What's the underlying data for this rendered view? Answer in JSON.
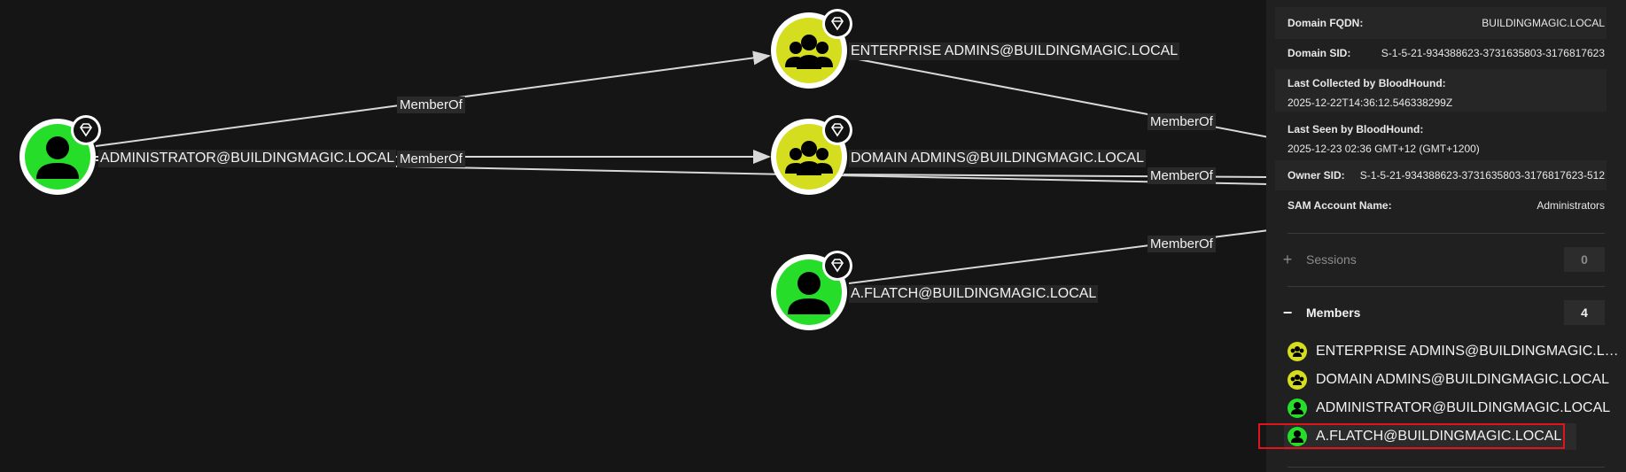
{
  "graph": {
    "nodes": {
      "administrator": {
        "label": "ADMINISTRATOR@BUILDINGMAGIC.LOCAL",
        "kind": "user",
        "icon": "user-icon",
        "badge": "tier-zero-gem-icon"
      },
      "enterprise_admins": {
        "label": "ENTERPRISE ADMINS@BUILDINGMAGIC.LOCAL",
        "kind": "group",
        "icon": "group-icon",
        "badge": "tier-zero-gem-icon"
      },
      "domain_admins": {
        "label": "DOMAIN ADMINS@BUILDINGMAGIC.LOCAL",
        "kind": "group",
        "icon": "group-icon",
        "badge": "tier-zero-gem-icon"
      },
      "aflatch": {
        "label": "A.FLATCH@BUILDINGMAGIC.LOCAL",
        "kind": "user",
        "icon": "user-icon",
        "badge": "tier-zero-gem-icon"
      }
    },
    "edges": [
      {
        "from": "ADMINISTRATOR@BUILDINGMAGIC.LOCAL",
        "to": "ENTERPRISE ADMINS@BUILDINGMAGIC.LOCAL",
        "label": "MemberOf"
      },
      {
        "from": "ADMINISTRATOR@BUILDINGMAGIC.LOCAL",
        "to": "DOMAIN ADMINS@BUILDINGMAGIC.LOCAL",
        "label": "MemberOf"
      },
      {
        "from": "ENTERPRISE ADMINS@BUILDINGMAGIC.LOCAL",
        "to": "Administrators",
        "label": "MemberOf"
      },
      {
        "from": "DOMAIN ADMINS@BUILDINGMAGIC.LOCAL",
        "to": "Administrators",
        "label": "MemberOf"
      },
      {
        "from": "A.FLATCH@BUILDINGMAGIC.LOCAL",
        "to": "Administrators",
        "label": "MemberOf"
      }
    ]
  },
  "panel": {
    "properties": [
      {
        "key": "Domain FQDN:",
        "value": "BUILDINGMAGIC.LOCAL"
      },
      {
        "key": "Domain SID:",
        "value": "S-1-5-21-934388623-3731635803-3176817623"
      },
      {
        "key": "Last Collected by BloodHound:",
        "value": "2025-12-22T14:36:12.546338299Z"
      },
      {
        "key": "Last Seen by BloodHound:",
        "value": "2025-12-23 02:36 GMT+12 (GMT+1200)"
      },
      {
        "key": "Owner SID:",
        "value": "S-1-5-21-934388623-3731635803-3176817623-512"
      },
      {
        "key": "SAM Account Name:",
        "value": "Administrators"
      }
    ],
    "sessions": {
      "symbol": "+",
      "label": "Sessions",
      "count": "0"
    },
    "members": {
      "symbol": "−",
      "label": "Members",
      "count": "4",
      "items": [
        {
          "label": "ENTERPRISE ADMINS@BUILDINGMAGIC.L…",
          "kind": "group",
          "icon": "group-icon"
        },
        {
          "label": "DOMAIN ADMINS@BUILDINGMAGIC.LOCAL",
          "kind": "group",
          "icon": "group-icon"
        },
        {
          "label": "ADMINISTRATOR@BUILDINGMAGIC.LOCAL",
          "kind": "user",
          "icon": "user-icon"
        },
        {
          "label": "A.FLATCH@BUILDINGMAGIC.LOCAL",
          "kind": "user",
          "icon": "user-icon",
          "selected": true
        }
      ]
    }
  },
  "colors": {
    "user": "#26dd2a",
    "group": "#d4dd1e",
    "background": "#151515",
    "panel": "#202020",
    "highlight": "#e0141c"
  }
}
